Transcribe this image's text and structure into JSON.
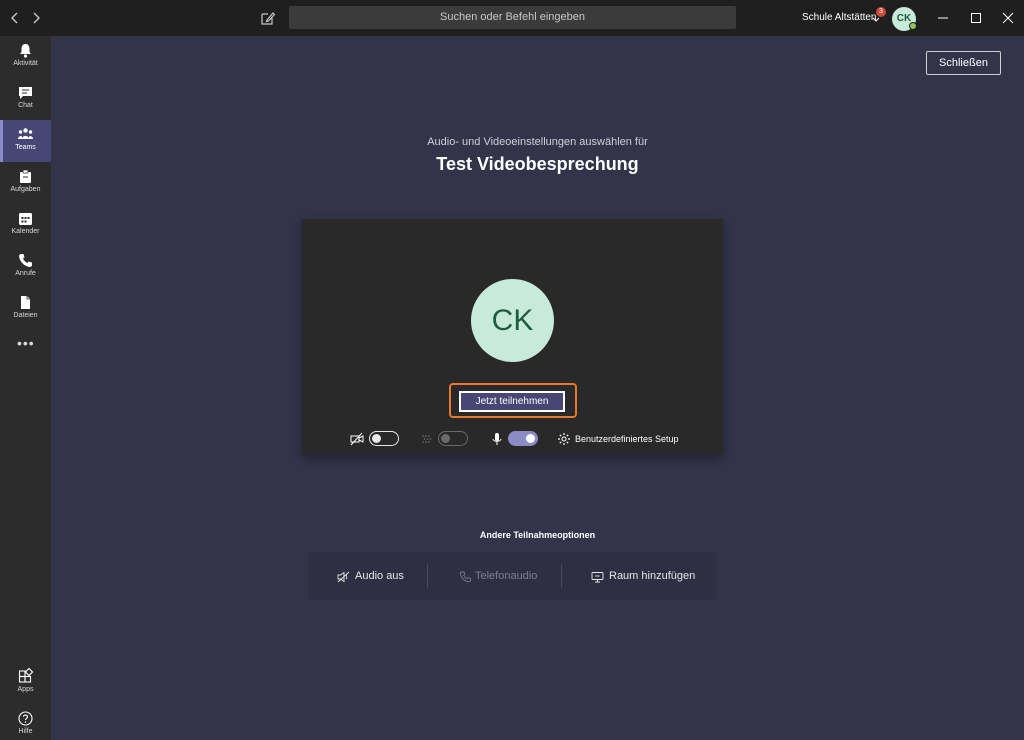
{
  "topbar": {
    "back_icon": "chevron-left-icon",
    "forward_icon": "chevron-right-icon",
    "compose_icon": "compose-icon",
    "search_placeholder": "Suchen oder Befehl eingeben",
    "org_name": "Schule Altstätten",
    "org_badge_count": "3",
    "avatar_initials": "CK",
    "window_controls": [
      "minimize-icon",
      "maximize-icon",
      "close-icon"
    ]
  },
  "rail": {
    "items": [
      {
        "label": "Aktivität",
        "icon": "bell-icon"
      },
      {
        "label": "Chat",
        "icon": "chat-icon"
      },
      {
        "label": "Teams",
        "icon": "teams-icon"
      },
      {
        "label": "Aufgaben",
        "icon": "assignments-icon"
      },
      {
        "label": "Kalender",
        "icon": "calendar-icon"
      },
      {
        "label": "Anrufe",
        "icon": "phone-icon"
      },
      {
        "label": "Dateien",
        "icon": "file-icon"
      }
    ],
    "active_index": 2,
    "more_label": "•••",
    "bottom": [
      {
        "label": "Apps",
        "icon": "apps-icon"
      },
      {
        "label": "Hilfe",
        "icon": "help-icon"
      }
    ]
  },
  "main": {
    "close_label": "Schließen",
    "subtitle": "Audio- und Videoeinstellungen auswählen für",
    "title": "Test Videobesprechung",
    "preview": {
      "avatar_initials": "CK",
      "join_label": "Jetzt teilnehmen",
      "camera_on": false,
      "blur_on": false,
      "mic_on": true,
      "setup_label": "Benutzerdefiniertes Setup"
    },
    "other_options_title": "Andere Teilnahmeoptionen",
    "other_options": [
      {
        "label": "Audio aus",
        "icon": "speaker-off-icon",
        "enabled": true
      },
      {
        "label": "Telefonaudio",
        "icon": "phone-icon",
        "enabled": false
      },
      {
        "label": "Raum hinzufügen",
        "icon": "room-icon",
        "enabled": true
      }
    ]
  },
  "colors": {
    "accent": "#464775",
    "accent_light": "#8b8cc7",
    "highlight_outline": "#e8782c",
    "avatar_bg": "#c8eadb",
    "background": "#33344a"
  }
}
